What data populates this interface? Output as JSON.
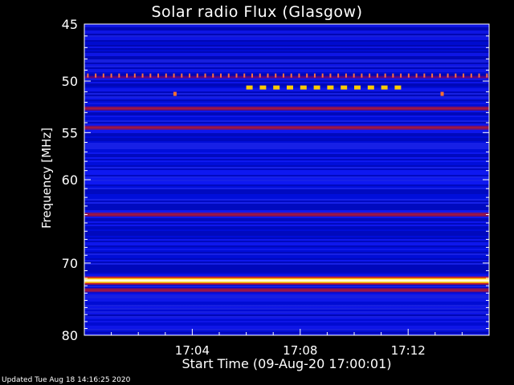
{
  "chart_data": {
    "type": "heatmap",
    "title": "Solar radio Flux (Glasgow)",
    "ylabel": "Frequency [MHz]",
    "xlabel": "Start Time (09-Aug-20 17:00:01)",
    "y_ticks": [
      "45",
      "50",
      "55",
      "60",
      "70",
      "80"
    ],
    "x_ticks": [
      "17:04",
      "17:08",
      "17:12"
    ],
    "x_range_minutes": [
      0,
      15
    ],
    "y_range_mhz": [
      45,
      80
    ],
    "y_scale": "log",
    "colormap": [
      "#000080",
      "#0000ff",
      "#3232ff",
      "#800060",
      "#cc2020",
      "#ffcc00",
      "#ffffcc"
    ],
    "bands": [
      {
        "mhz": 49.6,
        "intensity": "spiky",
        "note": "periodic dashed"
      },
      {
        "mhz": 50.6,
        "intensity": "high",
        "from_min": 6,
        "to_min": 11.6,
        "note": "dashed"
      },
      {
        "mhz": 52.6,
        "intensity": "medium"
      },
      {
        "mhz": 54.5,
        "intensity": "medium"
      },
      {
        "mhz": 64.0,
        "intensity": "medium"
      },
      {
        "mhz": 72.3,
        "intensity": "very-high"
      },
      {
        "mhz": 73.6,
        "intensity": "medium"
      }
    ]
  },
  "footer": "Updated Tue Aug 18 14:16:25 2020"
}
